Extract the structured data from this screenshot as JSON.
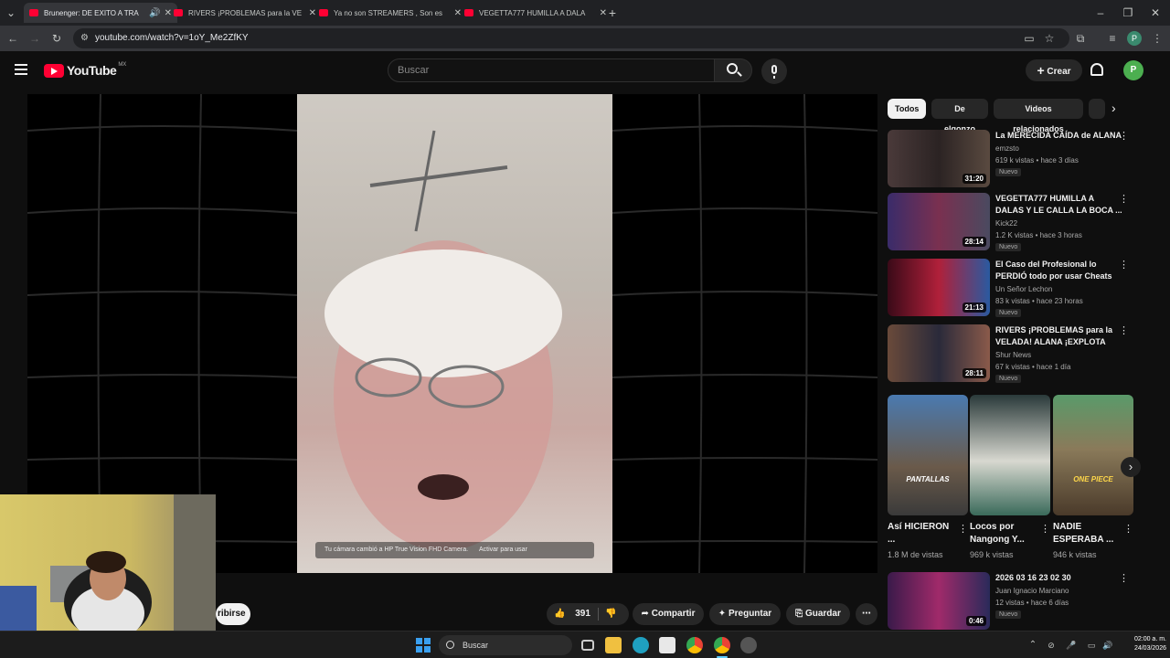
{
  "browser": {
    "tabs": [
      {
        "title": "Brunenger: DE EXITO A TRA"
      },
      {
        "title": "RIVERS ¡PROBLEMAS para la VE"
      },
      {
        "title": "Ya no son STREAMERS , Son es"
      },
      {
        "title": "VEGETTA777 HUMILLA A DALA"
      }
    ],
    "url": "youtube.com/watch?v=1oY_Me2ZfKY"
  },
  "youtube": {
    "logo_text": "YouTube",
    "region": "MX",
    "search_placeholder": "Buscar",
    "create_label": "Crear",
    "avatar_letter": "P"
  },
  "player": {
    "camera_toast": "Tu cámara cambió a HP True Vision FHD Camera.",
    "camera_toast_action": "Activar para usar"
  },
  "actions": {
    "subscribe_fragment": "ribirse",
    "likes": "391",
    "share": "Compartir",
    "ask": "Preguntar",
    "save": "Guardar"
  },
  "chips": [
    "Todos",
    "De elgonzo",
    "Videos relacionados"
  ],
  "recommendations": [
    {
      "title": "La MERECIDA CAÍDA de ALANA",
      "channel": "emzsto",
      "meta": "619 k vistas • hace 3 días",
      "badge": "Nuevo",
      "duration": "31:20"
    },
    {
      "title": "VEGETTA777 HUMILLA A DALAS Y LE CALLA LA BOCA ...",
      "channel": "Kick22",
      "meta": "1.2 K vistas • hace 3 horas",
      "badge": "Nuevo",
      "duration": "28:14"
    },
    {
      "title": "El Caso del Profesional lo PERDIÓ todo por usar Cheats -...",
      "channel": "Un Señor Lechon",
      "meta": "83 k vistas • hace 23 horas",
      "badge": "Nuevo",
      "duration": "21:13"
    },
    {
      "title": "RIVERS ¡PROBLEMAS para la VELADA! ALANA ¡EXPLOTA po...",
      "channel": "Shur News",
      "meta": "67 k vistas • hace 1 día",
      "badge": "Nuevo",
      "duration": "28:11"
    }
  ],
  "shorts": [
    {
      "title": "Así HICIERON ...",
      "views": "1.8 M de vistas",
      "overlay": "PANTALLAS"
    },
    {
      "title": "Locos por Nangong Y...",
      "views": "969 k vistas",
      "overlay": ""
    },
    {
      "title": "NADIE ESPERABA ...",
      "views": "946 k vistas",
      "overlay": "ONE PIECE"
    }
  ],
  "last_video": {
    "title": "2026 03 16 23 02 30",
    "channel": "Juan Ignacio Marciano",
    "meta": "12 vistas • hace 6 días",
    "badge": "Nuevo",
    "duration": "0:46"
  },
  "taskbar": {
    "search_label": "Buscar",
    "time": "02:00 a. m.",
    "date": "24/03/2026"
  },
  "colors": {
    "brand_red": "#ff0033",
    "background": "#0f0f0f",
    "chip": "#272727"
  }
}
